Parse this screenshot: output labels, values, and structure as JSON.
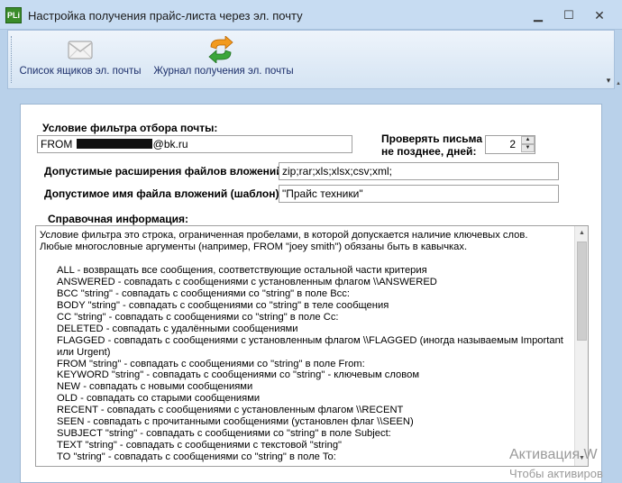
{
  "window": {
    "icon_text": "PLi",
    "title": "Настройка получения прайс-листа через эл. почту",
    "buttons": {
      "minimize": "▁",
      "maximize": "☐",
      "close": "✕"
    }
  },
  "toolbar": {
    "mail_list_label": "Список ящиков эл. почты",
    "mail_list_icon": "envelope-icon",
    "journal_label": "Журнал получения эл. почты",
    "journal_icon": "sync-arrows-icon",
    "overflow": "▾"
  },
  "form": {
    "filter_label": "Условие фильтра отбора почты:",
    "filter_value_prefix": "FROM ",
    "filter_value_suffix": "@bk.ru",
    "check_label_line1": "Проверять письма",
    "check_label_line2": "не позднее, дней:",
    "check_days": "2",
    "ext_label": "Допустимые расширения файлов вложений:",
    "ext_value": "zip;rar;xls;xlsx;csv;xml;",
    "name_label": "Допустимое имя файла вложений (шаблон):",
    "name_value": "\"Прайс техники\"",
    "info_label": "Справочная информация:"
  },
  "info": {
    "intro1": "Условие фильтра это строка, ограниченная пробелами, в которой допускается наличие ключевых слов.",
    "intro2": "Любые многословные аргументы (например, FROM \"joey smith\") обязаны быть в кавычках.",
    "items": [
      "ALL - возвращать все сообщения, соответствующие остальной части критерия",
      "ANSWERED - совпадать с сообщениями с установленным флагом \\\\ANSWERED",
      "BCC \"string\" - совпадать с сообщениями со \"string\" в поле Bcc:",
      "BODY \"string\" - совпадать с сообщениями со \"string\" в теле сообщения",
      "CC \"string\" - совпадать с сообщениями со \"string\" в поле Cc:",
      "DELETED - совпадать с удалёнными сообщениями",
      "FLAGGED - совпадать с сообщениями с установленным флагом \\\\FLAGGED (иногда называемым Important или Urgent)",
      "FROM \"string\" - совпадать с сообщениями со \"string\" в поле From:",
      "KEYWORD \"string\" - совпадать с сообщениями со \"string\" - ключевым словом",
      "NEW - совпадать с новыми сообщениями",
      "OLD - совпадать со старыми сообщениями",
      "RECENT - совпадать с сообщениями с установленным флагом \\\\RECENT",
      "SEEN - совпадать с прочитанными сообщениями (установлен флаг \\\\SEEN)",
      "SUBJECT \"string\" - совпадать с сообщениями со \"string\" в поле Subject:",
      "TEXT \"string\" - совпадать с сообщениями с текстовой \"string\"",
      "TO \"string\" - совпадать с сообщениями со \"string\" в поле To:"
    ]
  },
  "watermark": {
    "line1": "Активация W",
    "line2": "Чтобы активиров"
  }
}
